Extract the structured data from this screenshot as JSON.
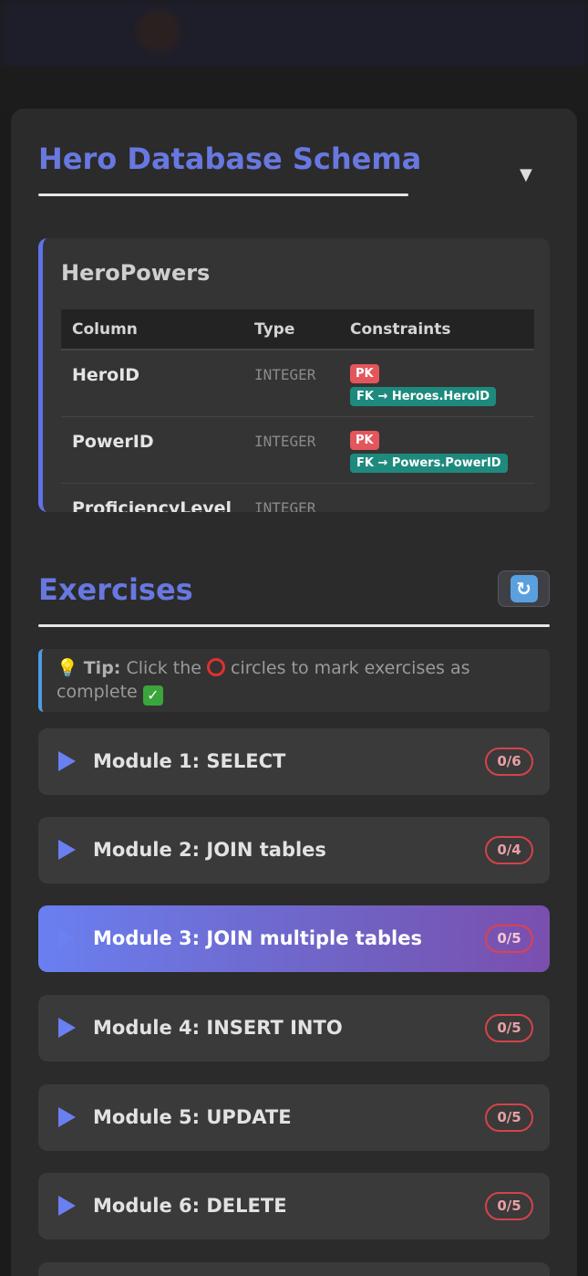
{
  "schema": {
    "title": "Hero Database Schema",
    "toggle_icon": "▼",
    "table": {
      "name": "HeroPowers",
      "headers": [
        "Column",
        "Type",
        "Constraints"
      ],
      "rows": [
        {
          "column": "HeroID",
          "type": "INTEGER",
          "pk": "PK",
          "fk": "FK → Heroes.HeroID"
        },
        {
          "column": "PowerID",
          "type": "INTEGER",
          "pk": "PK",
          "fk": "FK → Powers.PowerID"
        },
        {
          "column": "ProficiencyLevel",
          "type": "INTEGER"
        }
      ]
    }
  },
  "exercises": {
    "title": "Exercises",
    "refresh_icon": "refresh-icon",
    "tip": {
      "icon": "💡",
      "label": "Tip:",
      "text_before": "Click the",
      "text_after": "circles to mark exercises as complete"
    },
    "modules": [
      {
        "label": "Module 1: SELECT",
        "count": "0/6"
      },
      {
        "label": "Module 2: JOIN tables",
        "count": "0/4"
      },
      {
        "label": "Module 3: JOIN multiple tables",
        "count": "0/5",
        "active": true
      },
      {
        "label": "Module 4: INSERT INTO",
        "count": "0/5"
      },
      {
        "label": "Module 5: UPDATE",
        "count": "0/5"
      },
      {
        "label": "Module 6: DELETE",
        "count": "0/5"
      }
    ]
  },
  "colors": {
    "accent": "#6878e0",
    "pk_badge": "#e3565c",
    "fk_badge": "#1e8a7e",
    "tip_border": "#4f9be0",
    "count_border": "#d4434a"
  }
}
